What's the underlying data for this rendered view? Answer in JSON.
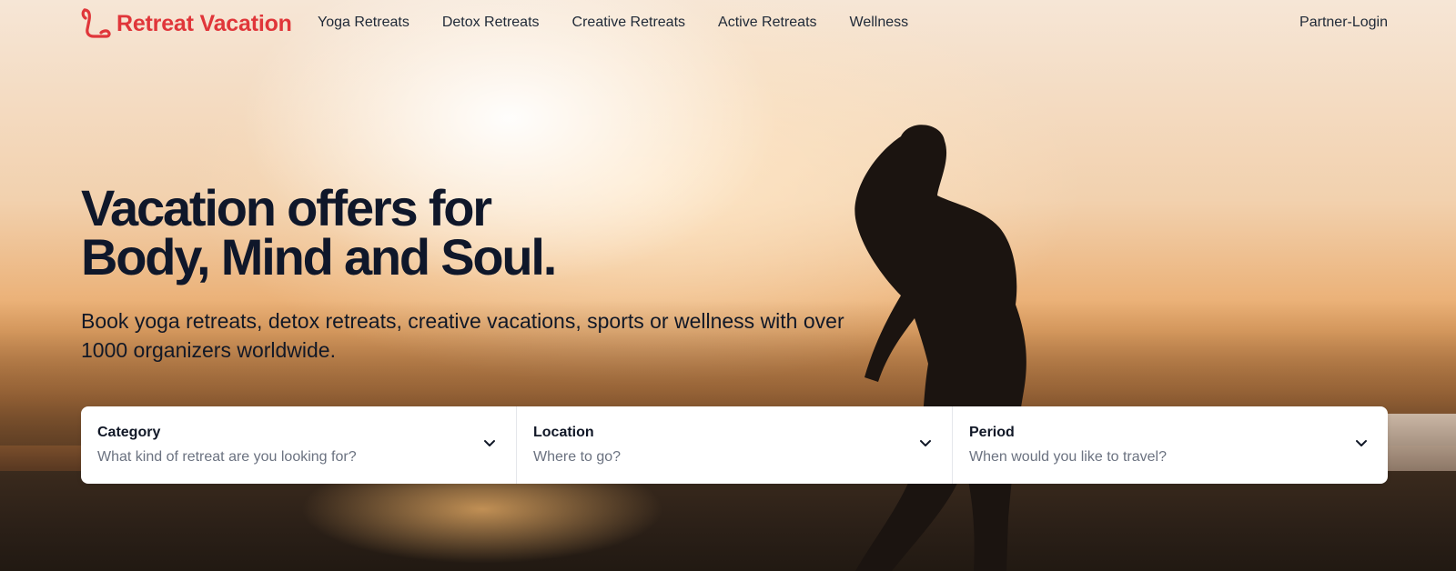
{
  "brand": {
    "name": "Retreat Vacation",
    "accent": "#e0363a",
    "logo_icon": "logo-icon"
  },
  "nav": {
    "links": [
      "Yoga Retreats",
      "Detox Retreats",
      "Creative Retreats",
      "Active Retreats",
      "Wellness"
    ],
    "partner_login": "Partner-Login"
  },
  "hero": {
    "headline_line1": "Vacation offers for",
    "headline_line2": "Body, Mind and Soul.",
    "subtitle": "Book yoga retreats, detox retreats, creative vacations, sports or wellness with over 1000 organizers worldwide."
  },
  "search": {
    "fields": [
      {
        "label": "Category",
        "placeholder": "What kind of retreat are you looking for?",
        "icon": "chevron-down-icon"
      },
      {
        "label": "Location",
        "placeholder": "Where to go?",
        "icon": "chevron-down-icon"
      },
      {
        "label": "Period",
        "placeholder": "When would you like to travel?",
        "icon": "chevron-down-icon"
      }
    ]
  }
}
